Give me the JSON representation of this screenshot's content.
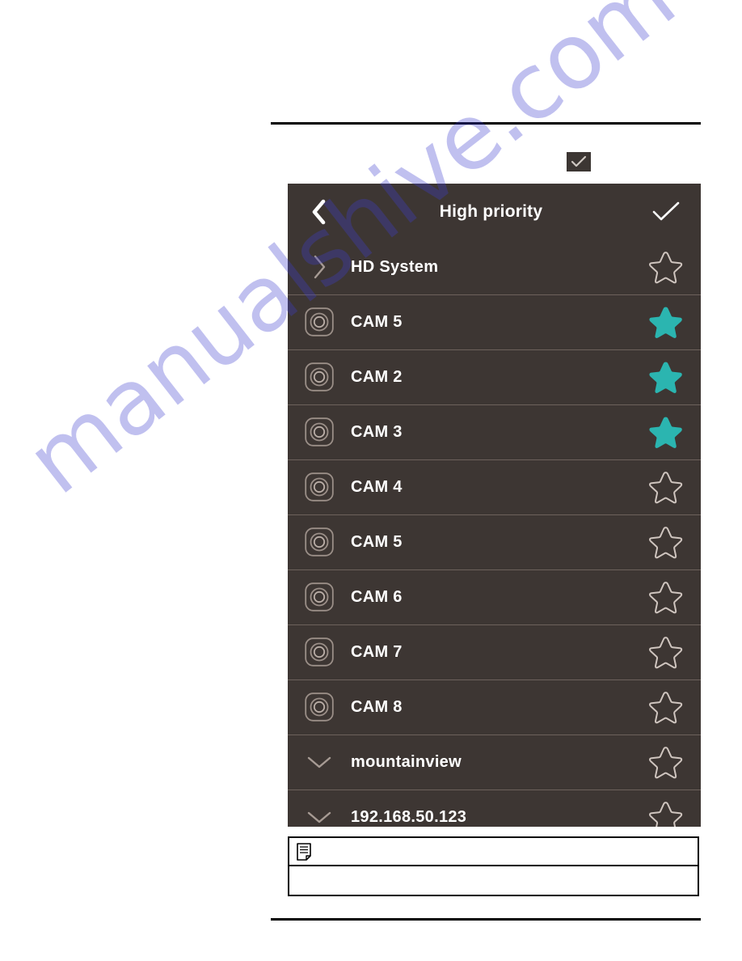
{
  "page": {
    "rules": [
      "top-rule",
      "bottom-rule"
    ],
    "watermark_text": "manualshive.com",
    "watermark_color": "#3f3fd0"
  },
  "badge": {
    "icon": "check-icon",
    "label": ""
  },
  "panel": {
    "background_color": "#3d3633",
    "divider_color": "#6d625c",
    "header": {
      "back_icon": "chevron-left-icon",
      "title": "High priority",
      "confirm_icon": "check-icon"
    },
    "accent_color": "#2bb5b0",
    "rows": [
      {
        "label": "HD System",
        "lead_icon": "chevron-right-icon",
        "starred": false,
        "type": "group"
      },
      {
        "label": "CAM 5",
        "lead_icon": "camera-icon",
        "starred": true,
        "type": "camera"
      },
      {
        "label": "CAM 2",
        "lead_icon": "camera-icon",
        "starred": true,
        "type": "camera"
      },
      {
        "label": "CAM 3",
        "lead_icon": "camera-icon",
        "starred": true,
        "type": "camera"
      },
      {
        "label": "CAM 4",
        "lead_icon": "camera-icon",
        "starred": false,
        "type": "camera"
      },
      {
        "label": "CAM 5",
        "lead_icon": "camera-icon",
        "starred": false,
        "type": "camera"
      },
      {
        "label": "CAM 6",
        "lead_icon": "camera-icon",
        "starred": false,
        "type": "camera"
      },
      {
        "label": "CAM 7",
        "lead_icon": "camera-icon",
        "starred": false,
        "type": "camera"
      },
      {
        "label": "CAM 8",
        "lead_icon": "camera-icon",
        "starred": false,
        "type": "camera"
      },
      {
        "label": "mountainview",
        "lead_icon": "chevron-down-icon",
        "starred": false,
        "type": "group"
      },
      {
        "label": "192.168.50.123",
        "lead_icon": "chevron-down-icon",
        "starred": false,
        "type": "group"
      }
    ]
  },
  "note": {
    "icon": "note-document-icon",
    "header_text": "",
    "body_text": ""
  }
}
